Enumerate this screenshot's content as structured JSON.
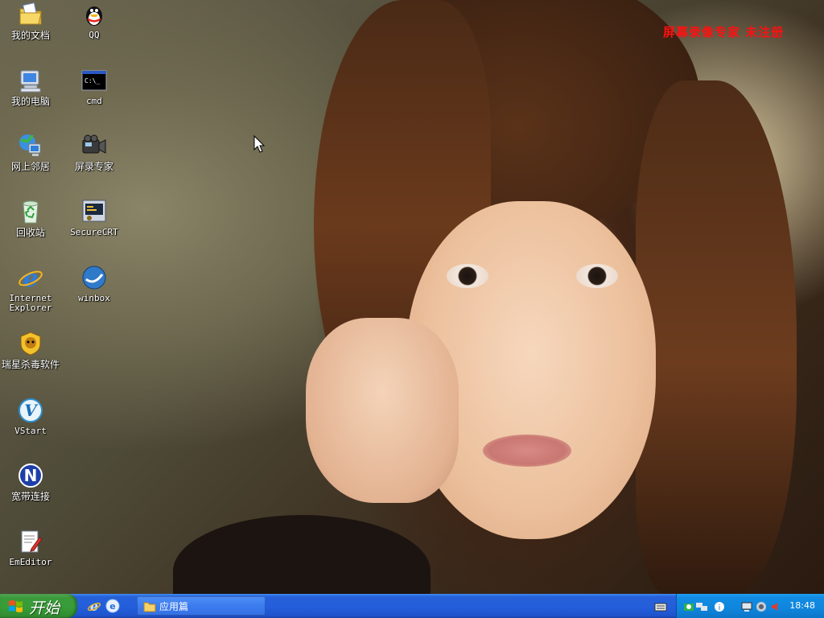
{
  "watermark": "屏幕录像专家 未注册",
  "desktop_icons": [
    {
      "label": "我的文档",
      "icon": "my-documents-icon"
    },
    {
      "label": "QQ",
      "icon": "qq-penguin-icon"
    },
    {
      "label": "我的电脑",
      "icon": "my-computer-icon"
    },
    {
      "label": "cmd",
      "icon": "cmd-icon"
    },
    {
      "label": "网上邻居",
      "icon": "network-places-icon"
    },
    {
      "label": "屏录专家",
      "icon": "screen-recorder-icon"
    },
    {
      "label": "回收站",
      "icon": "recycle-bin-icon"
    },
    {
      "label": "SecureCRT",
      "icon": "securecrt-icon"
    },
    {
      "label": "Internet\nExplorer",
      "icon": "internet-explorer-icon"
    },
    {
      "label": "winbox",
      "icon": "winbox-icon"
    },
    {
      "label": "瑞星杀毒软件",
      "icon": "rising-antivirus-icon"
    },
    {
      "label": "VStart",
      "icon": "vstart-icon"
    },
    {
      "label": "宽带连接",
      "icon": "broadband-connection-icon"
    },
    {
      "label": "EmEditor",
      "icon": "emeditor-icon"
    }
  ],
  "taskbar": {
    "start_label": "开始",
    "task_button_label": "应用篇",
    "clock": "18:48"
  },
  "colors": {
    "taskbar_blue": "#245edb",
    "start_green": "#389c38",
    "tray_blue": "#0f86dd",
    "watermark_red": "#ff1010"
  }
}
